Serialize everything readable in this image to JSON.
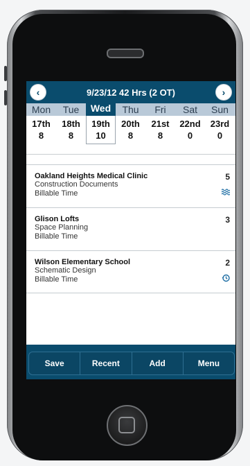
{
  "header": {
    "title": "9/23/12  42 Hrs (2 OT)",
    "prev_icon": "chevron-left-icon",
    "next_icon": "chevron-right-icon"
  },
  "week": {
    "days": [
      {
        "name": "Mon",
        "date": "17th",
        "hours": "8"
      },
      {
        "name": "Tue",
        "date": "18th",
        "hours": "8"
      },
      {
        "name": "Wed",
        "date": "19th",
        "hours": "10",
        "selected": true
      },
      {
        "name": "Thu",
        "date": "20th",
        "hours": "8"
      },
      {
        "name": "Fri",
        "date": "21st",
        "hours": "8"
      },
      {
        "name": "Sat",
        "date": "22nd",
        "hours": "0"
      },
      {
        "name": "Sun",
        "date": "23rd",
        "hours": "0"
      }
    ]
  },
  "entries": [
    {
      "project": "Oakland Heights Medical Clinic",
      "phase": "Construction Documents",
      "type": "Billable Time",
      "hours": "5",
      "icon": "waves-icon"
    },
    {
      "project": "Glison Lofts",
      "phase": "Space Planning",
      "type": "Billable Time",
      "hours": "3",
      "icon": ""
    },
    {
      "project": "Wilson Elementary School",
      "phase": "Schematic Design",
      "type": "Billable Time",
      "hours": "2",
      "icon": "history-icon"
    }
  ],
  "toolbar": {
    "save_label": "Save",
    "recent_label": "Recent",
    "add_label": "Add",
    "menu_label": "Menu"
  },
  "colors": {
    "accent": "#0a4c6d",
    "day_strip": "#b9c9d8",
    "icon": "#1f6fa5"
  }
}
